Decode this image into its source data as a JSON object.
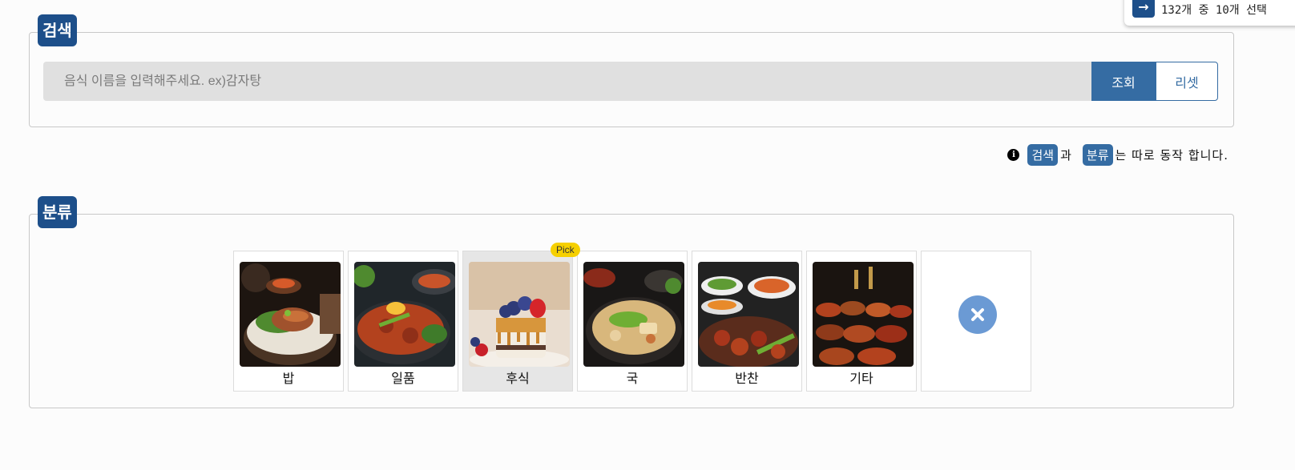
{
  "search": {
    "legend": "검색",
    "placeholder": "음식 이름을 입력해주세요. ex)감자탕",
    "value": "",
    "search_button": "조회",
    "reset_button": "리셋"
  },
  "info": {
    "badge_search": "검색",
    "text_and": "과",
    "badge_category": "분류",
    "text_rest": "는 따로 동작 합니다."
  },
  "category": {
    "legend": "분류",
    "pick_badge": "Pick",
    "items": [
      {
        "label": "밥",
        "icon": "rice-bowl-photo"
      },
      {
        "label": "일품",
        "icon": "main-dish-photo"
      },
      {
        "label": "후식",
        "icon": "dessert-photo",
        "selected": true
      },
      {
        "label": "국",
        "icon": "soup-photo"
      },
      {
        "label": "반찬",
        "icon": "side-dish-photo"
      },
      {
        "label": "기타",
        "icon": "etc-dishes-photo"
      }
    ],
    "clear_icon": "close-icon"
  },
  "toast": {
    "arrow": "→",
    "text": "132개 중 10개 선택"
  },
  "colors": {
    "accent": "#1d4f8a",
    "button": "#356ca3",
    "pick": "#f6d000",
    "clear": "#6b9ad4"
  }
}
